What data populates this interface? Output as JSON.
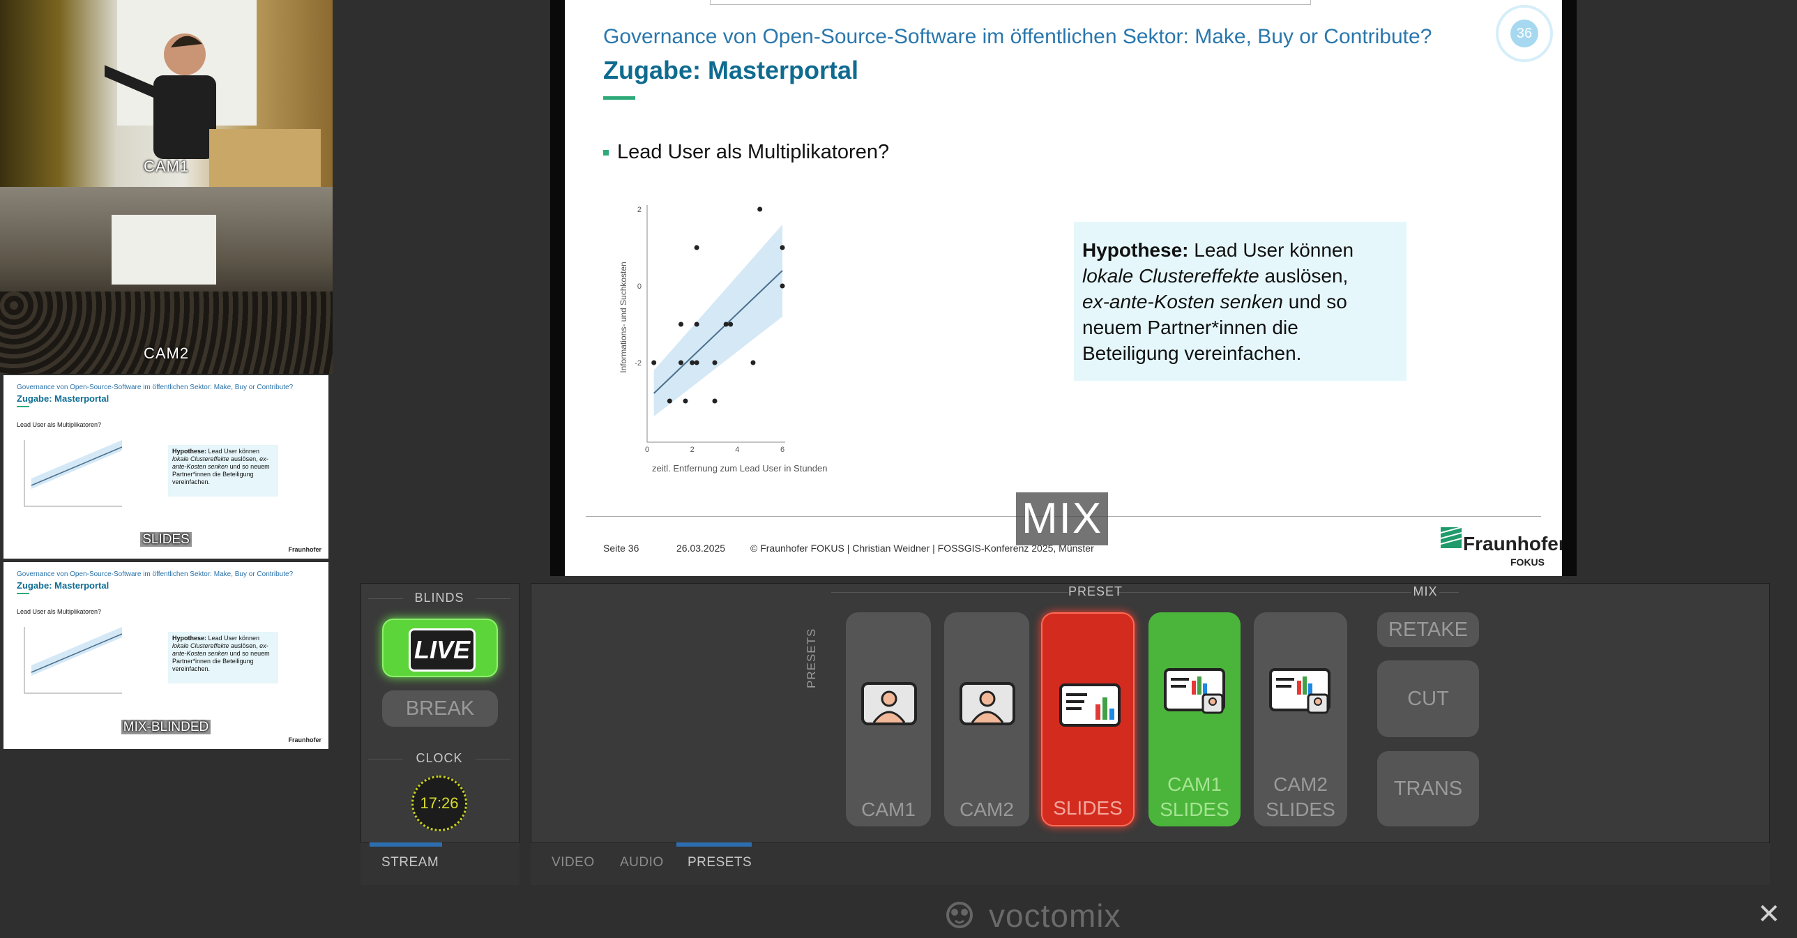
{
  "sources": {
    "cam1_label": "CAM1",
    "cam2_label": "CAM2",
    "slides_label": "SLIDES",
    "mix_blinded_label": "MIX-BLINDED"
  },
  "slide": {
    "header": "Governance von Open-Source-Software im öffentlichen Sektor: Make, Buy or Contribute?",
    "title": "Zugabe: Masterportal",
    "bullet": "Lead User als Multiplikatoren?",
    "hyp_bold": "Hypothese:",
    "hyp_line1": " Lead User können",
    "hyp_italic1": "lokale Clustereffekte",
    "hyp_line2": " auslösen,",
    "hyp_italic2": "ex-ante-Kosten senken",
    "hyp_line3": " und so",
    "hyp_line4": "neuem Partner*innen die",
    "hyp_line5": "Beteiligung vereinfachen.",
    "page_number": "36",
    "footer_page": "Seite 36",
    "footer_date": "26.03.2025",
    "footer_copy": "© Fraunhofer FOKUS | Christian Weidner | FOSSGIS-Konferenz 2025, Münster",
    "logo_name": "Fraunhofer",
    "logo_sub": "FOKUS",
    "chart_ylabel": "Informations- und Suchkosten",
    "chart_xlabel": "zeitl. Entfernung zum Lead User in Stunden",
    "output_label": "MIX"
  },
  "chart_data": {
    "type": "scatter",
    "title": "",
    "xlabel": "zeitl. Entfernung zum Lead User in Stunden",
    "ylabel": "Informations- und Suchkosten",
    "xlim": [
      0,
      6
    ],
    "ylim": [
      -4,
      2
    ],
    "x_ticks": [
      "0",
      "2",
      "4",
      "6"
    ],
    "y_ticks": [
      "-2",
      "0",
      "2"
    ],
    "points": [
      {
        "x": 0.3,
        "y": -2.0
      },
      {
        "x": 1.0,
        "y": -3.0
      },
      {
        "x": 1.5,
        "y": -1.0
      },
      {
        "x": 1.5,
        "y": -2.0
      },
      {
        "x": 1.7,
        "y": -3.0
      },
      {
        "x": 2.0,
        "y": -2.0
      },
      {
        "x": 2.2,
        "y": -1.0
      },
      {
        "x": 2.2,
        "y": -2.0
      },
      {
        "x": 2.2,
        "y": 1.0
      },
      {
        "x": 3.0,
        "y": -2.0
      },
      {
        "x": 3.0,
        "y": -3.0
      },
      {
        "x": 3.5,
        "y": -1.0
      },
      {
        "x": 3.7,
        "y": -1.0
      },
      {
        "x": 4.7,
        "y": -2.0
      },
      {
        "x": 5.0,
        "y": 2.0
      },
      {
        "x": 6.0,
        "y": 1.0
      },
      {
        "x": 6.0,
        "y": 0.0
      }
    ],
    "trend": {
      "x": [
        0.3,
        6.0
      ],
      "y": [
        -2.8,
        0.4
      ]
    }
  },
  "blinds": {
    "head": "BLINDS",
    "live": "LIVE",
    "break": "BREAK"
  },
  "clock": {
    "head": "CLOCK",
    "time": "17:26"
  },
  "left_tabs": {
    "stream": "STREAM"
  },
  "main": {
    "preset_head": "PRESET",
    "mix_head": "MIX",
    "presets_side": "PRESETS",
    "presets": [
      {
        "line1": "CAM1",
        "line2": "",
        "icon": "person-icon",
        "state": "idle"
      },
      {
        "line1": "CAM2",
        "line2": "",
        "icon": "person-icon",
        "state": "idle"
      },
      {
        "line1": "SLIDES",
        "line2": "",
        "icon": "slides-icon",
        "state": "live"
      },
      {
        "line1": "CAM1",
        "line2": "SLIDES",
        "icon": "slides-with-person-icon",
        "state": "preview"
      },
      {
        "line1": "CAM2",
        "line2": "SLIDES",
        "icon": "slides-with-person-icon",
        "state": "idle"
      }
    ],
    "retake": "RETAKE",
    "cut": "CUT",
    "trans": "TRANS",
    "tabs": {
      "video": "VIDEO",
      "audio": "AUDIO",
      "presets": "PRESETS"
    }
  },
  "footer": {
    "brand": "voctomix"
  },
  "colors": {
    "live_red": "#d42b1f",
    "preview_green": "#4ab53a",
    "tab_accent": "#2d6eb0",
    "clock_yellow": "#d8dc2a"
  }
}
